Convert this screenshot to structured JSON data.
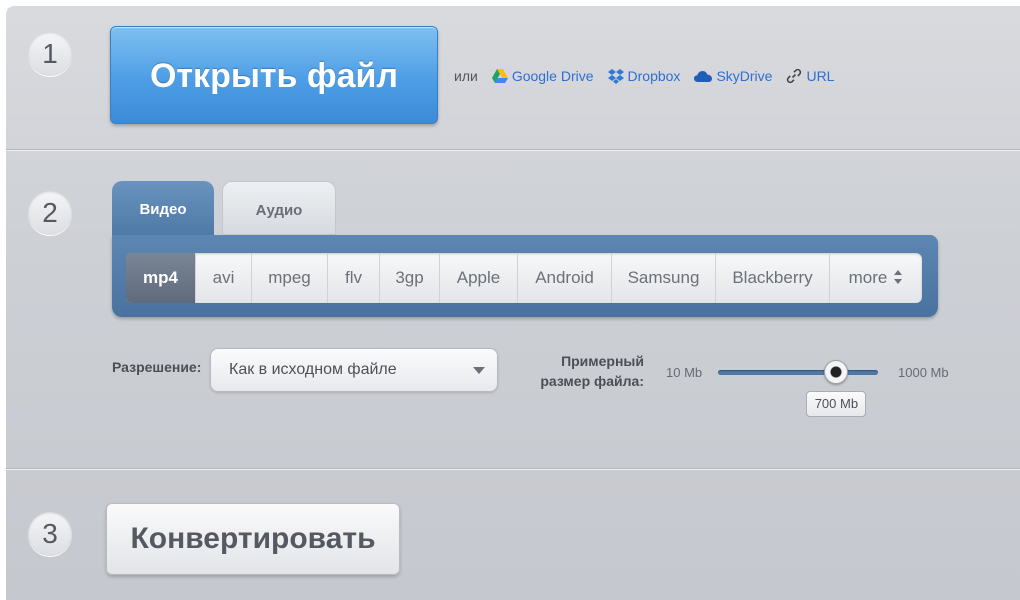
{
  "steps": {
    "one": "1",
    "two": "2",
    "three": "3"
  },
  "open": {
    "button_label": "Открыть файл",
    "or_label": "или",
    "sources": [
      {
        "label": "Google Drive",
        "icon": "google-drive-icon"
      },
      {
        "label": "Dropbox",
        "icon": "dropbox-icon"
      },
      {
        "label": "SkyDrive",
        "icon": "skydrive-icon"
      },
      {
        "label": "URL",
        "icon": "link-icon"
      }
    ]
  },
  "tabs": [
    {
      "label": "Видео",
      "active": true
    },
    {
      "label": "Аудио",
      "active": false
    }
  ],
  "formats": [
    {
      "label": "mp4",
      "active": true
    },
    {
      "label": "avi"
    },
    {
      "label": "mpeg"
    },
    {
      "label": "flv"
    },
    {
      "label": "3gp"
    },
    {
      "label": "Apple"
    },
    {
      "label": "Android"
    },
    {
      "label": "Samsung"
    },
    {
      "label": "Blackberry"
    },
    {
      "label": "more"
    }
  ],
  "resolution": {
    "label": "Разрешение:",
    "value": "Как в исходном файле"
  },
  "size": {
    "label_line1": "Примерный",
    "label_line2": "размер файла:",
    "min_label": "10 Mb",
    "max_label": "1000 Mb",
    "current_label": "700 Mb",
    "fraction": 0.74
  },
  "convert": {
    "button_label": "Конвертировать"
  },
  "colors": {
    "accent": "#4d9ee6",
    "link": "#2f6fcf",
    "tab_active": "#5d86b2"
  }
}
